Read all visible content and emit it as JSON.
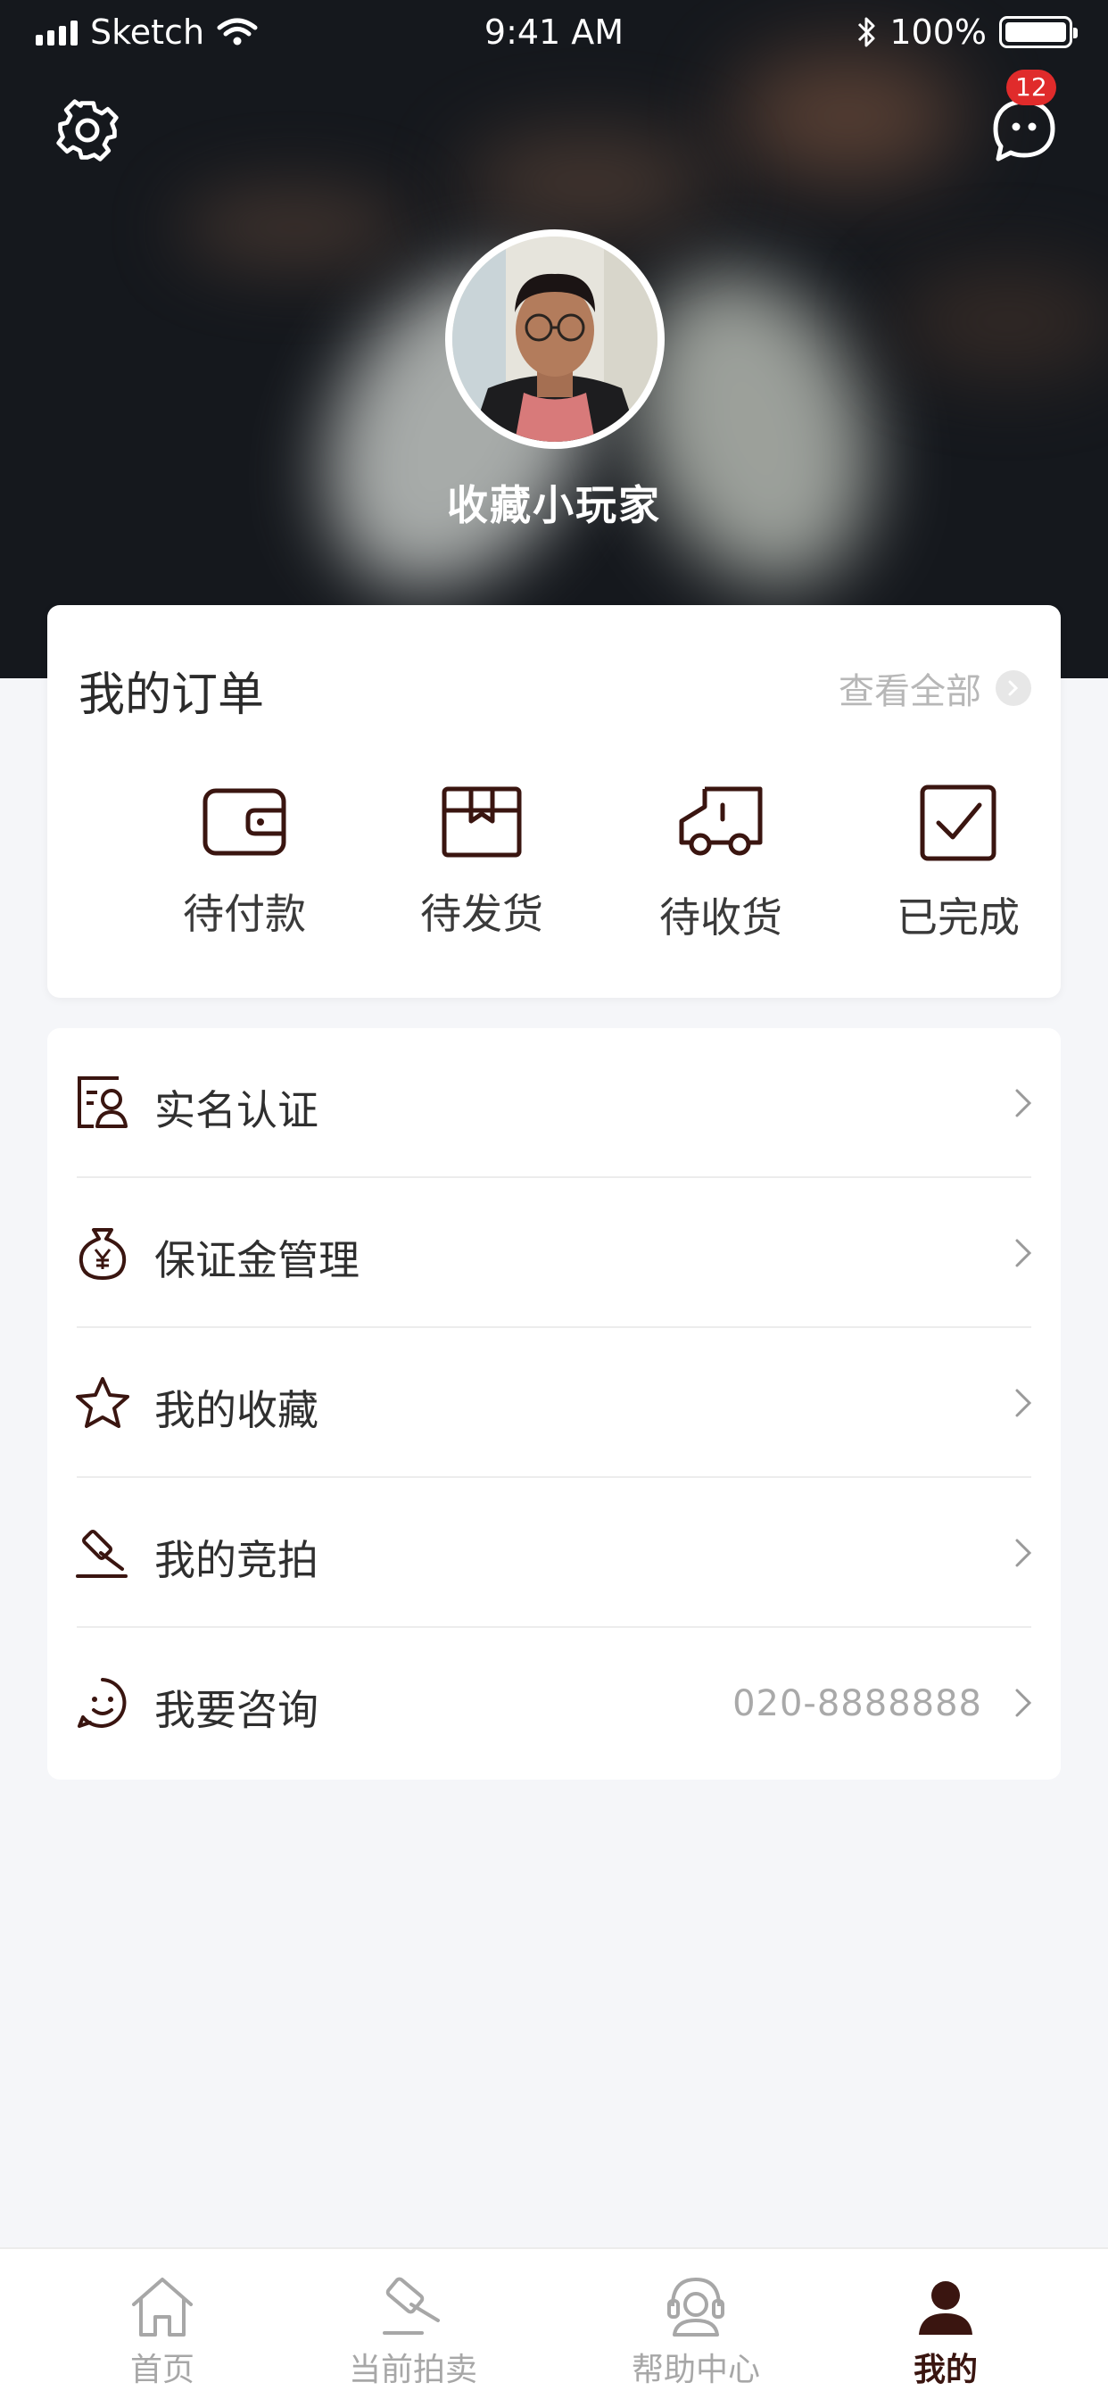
{
  "status_bar": {
    "carrier": "Sketch",
    "time": "9:41 AM",
    "battery": "100%"
  },
  "header": {
    "message_badge": "12",
    "username": "收藏小玩家"
  },
  "orders": {
    "title": "我的订单",
    "view_all": "查看全部",
    "items": [
      {
        "label": "待付款",
        "icon": "wallet-icon"
      },
      {
        "label": "待发货",
        "icon": "package-icon"
      },
      {
        "label": "待收货",
        "icon": "truck-icon"
      },
      {
        "label": "已完成",
        "icon": "checkbox-icon"
      }
    ]
  },
  "menu": {
    "items": [
      {
        "label": "实名认证",
        "icon": "id-card-icon",
        "extra": ""
      },
      {
        "label": "保证金管理",
        "icon": "money-bag-icon",
        "extra": ""
      },
      {
        "label": "我的收藏",
        "icon": "star-icon",
        "extra": ""
      },
      {
        "label": "我的竞拍",
        "icon": "gavel-icon",
        "extra": ""
      },
      {
        "label": "我要咨询",
        "icon": "smile-icon",
        "extra": "020-8888888"
      }
    ]
  },
  "tabbar": {
    "tabs": [
      {
        "label": "首页",
        "icon": "home-icon"
      },
      {
        "label": "当前拍卖",
        "icon": "gavel-icon"
      },
      {
        "label": "帮助中心",
        "icon": "headset-icon"
      },
      {
        "label": "我的",
        "icon": "person-icon"
      }
    ],
    "active_index": 3
  },
  "colors": {
    "accent": "#3a1510",
    "badge": "#e02b2b",
    "background": "#f5f6f9"
  }
}
